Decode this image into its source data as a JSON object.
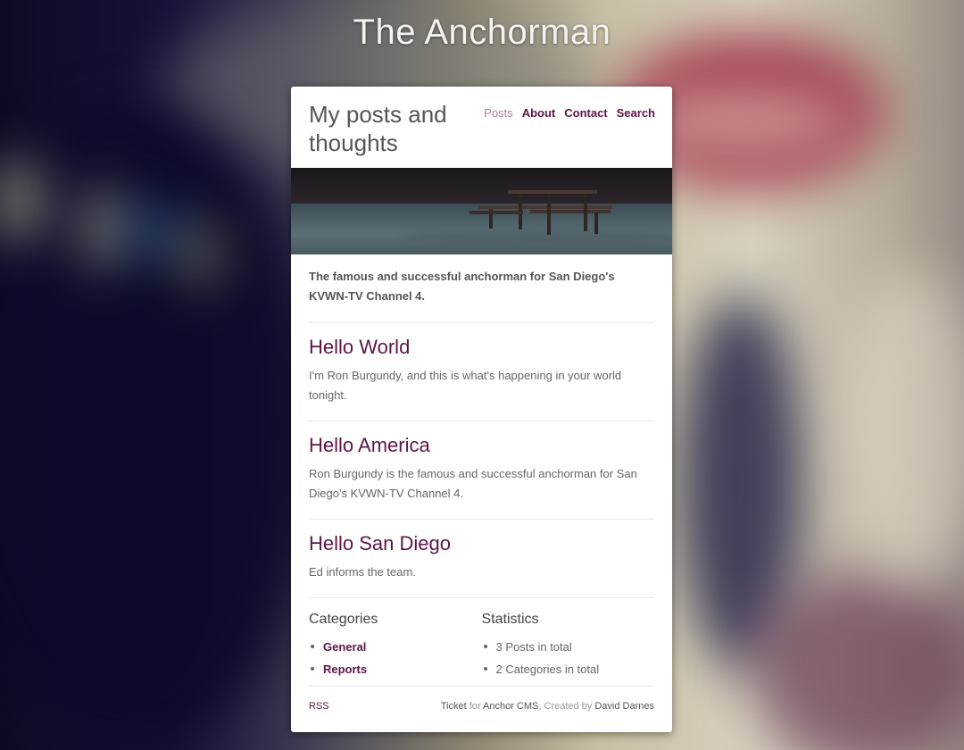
{
  "site": {
    "title": "The Anchorman",
    "tagline": "My posts and thoughts"
  },
  "nav": [
    {
      "label": "Posts",
      "active": true
    },
    {
      "label": "About",
      "active": false
    },
    {
      "label": "Contact",
      "active": false
    },
    {
      "label": "Search",
      "active": false
    }
  ],
  "intro": "The famous and successful anchorman for San Diego's KVWN-TV Channel 4.",
  "posts": [
    {
      "title": "Hello World",
      "excerpt": "I'm Ron Burgundy, and this is what's happening in your world tonight."
    },
    {
      "title": "Hello America",
      "excerpt": "Ron Burgundy is the famous and successful anchorman for San Diego's KVWN-TV Channel 4."
    },
    {
      "title": "Hello San Diego",
      "excerpt": "Ed informs the team."
    }
  ],
  "categories": {
    "heading": "Categories",
    "items": [
      "General",
      "Reports"
    ]
  },
  "statistics": {
    "heading": "Statistics",
    "items": [
      "3 Posts in total",
      "2 Categories in total"
    ]
  },
  "footer": {
    "rss": "RSS",
    "ticket": "Ticket",
    "for": "for",
    "anchor_cms": "Anchor CMS",
    "created_by": ", Created by",
    "author": "David Darnes"
  },
  "colors": {
    "accent": "#5e1548",
    "accent_muted": "#b27fa0"
  }
}
